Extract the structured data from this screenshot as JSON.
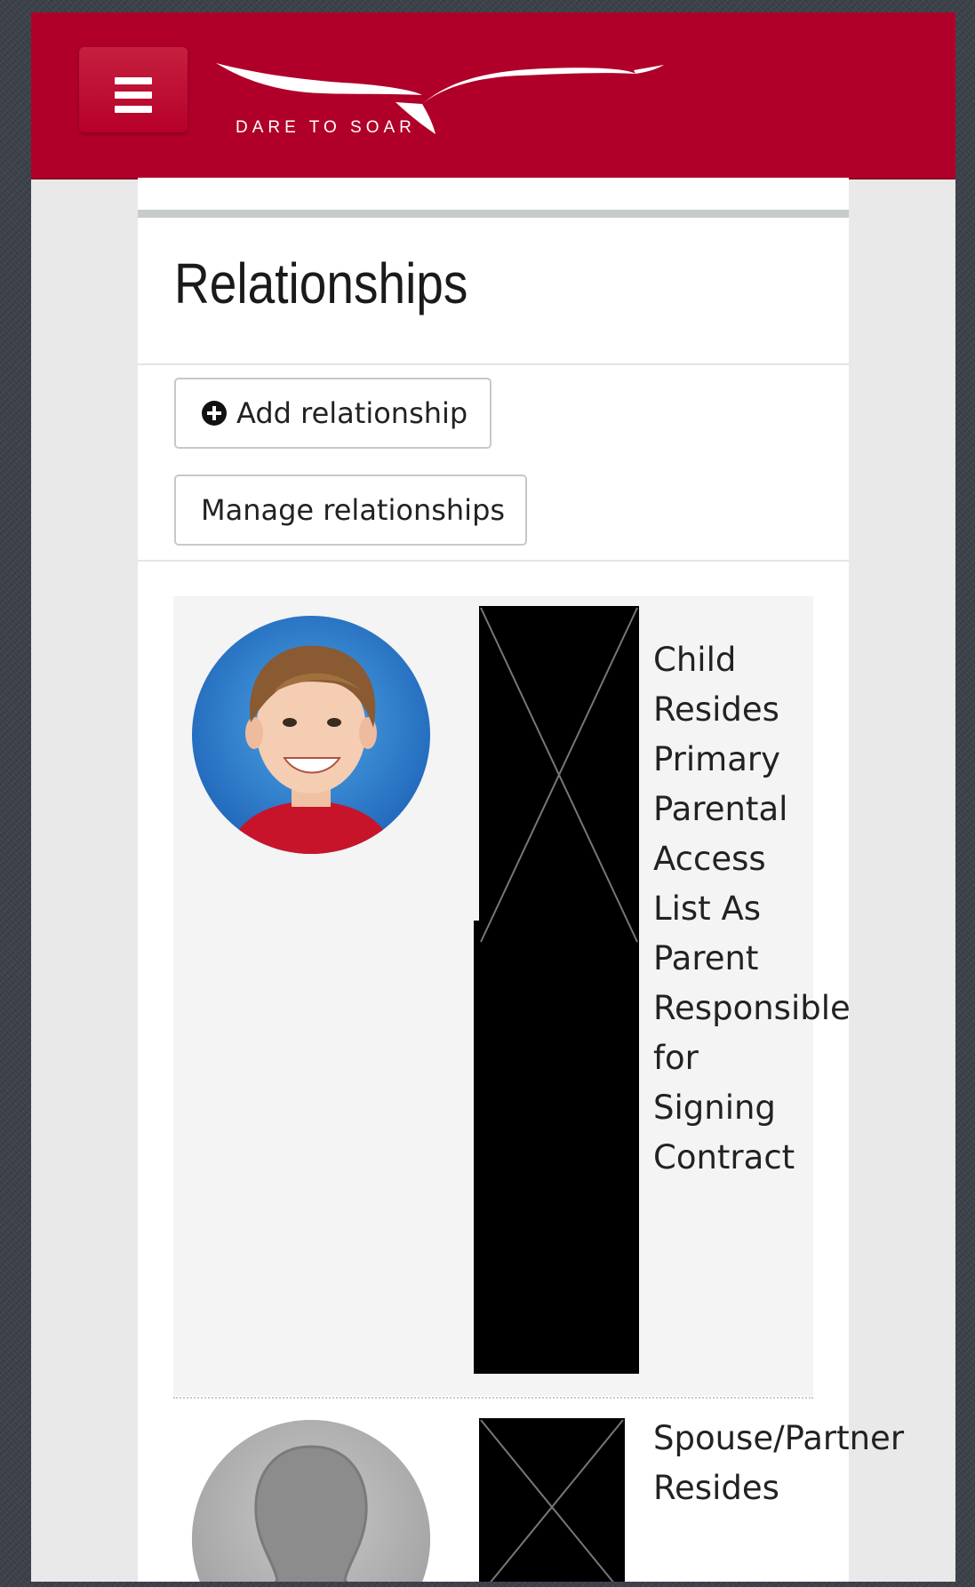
{
  "header": {
    "brand_tagline": "DARE TO SOAR",
    "menu_icon": "hamburger-icon",
    "brand_color": "#b0002a"
  },
  "page": {
    "title": "Relationships"
  },
  "actions": {
    "add_label": "Add relationship",
    "add_icon": "plus-circle-icon",
    "manage_label": "Manage relationships"
  },
  "relationships": [
    {
      "avatar": "student-photo",
      "name_redacted": true,
      "lines": [
        "Child",
        "Resides",
        "Primary",
        "Parental",
        "Access",
        "List As",
        "Parent",
        "Responsible",
        "for",
        "Signing",
        "Contract"
      ]
    },
    {
      "avatar": "default-avatar-silhouette",
      "name_redacted": true,
      "lines": [
        "Spouse/Partner",
        "Resides"
      ]
    }
  ]
}
